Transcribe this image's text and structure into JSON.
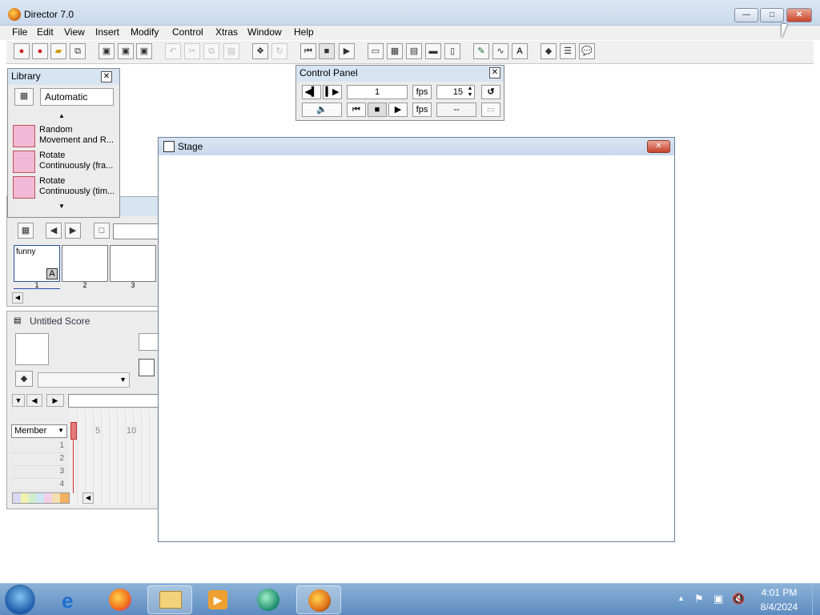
{
  "window": {
    "title": "Director 7.0",
    "min_glyph": "—",
    "max_glyph": "□",
    "close_glyph": "✕"
  },
  "menu": {
    "items": [
      "File",
      "Edit",
      "View",
      "Insert",
      "Modify",
      "Control",
      "Xtras",
      "Window",
      "Help"
    ]
  },
  "library": {
    "title": "Library",
    "category": "Automatic",
    "items": [
      {
        "line1": "Random",
        "line2": "Movement and R..."
      },
      {
        "line1": "Rotate",
        "line2": "Continuously (fra..."
      },
      {
        "line1": "Rotate",
        "line2": "Continuously (tim..."
      }
    ]
  },
  "control_panel": {
    "title": "Control Panel",
    "frame": "1",
    "fps_label": "fps",
    "tempo": "15",
    "actual_fps": "--"
  },
  "cast": {
    "thumbs": [
      {
        "label": "funny",
        "number": "1"
      },
      {
        "label": "",
        "number": "2"
      },
      {
        "label": "",
        "number": "3"
      }
    ]
  },
  "score": {
    "title": "Untitled Score",
    "member_label": "Member",
    "frame_ticks": [
      "5",
      "10"
    ],
    "channels": [
      "1",
      "2",
      "3",
      "4"
    ]
  },
  "stage": {
    "title": "Stage"
  },
  "taskbar": {
    "time": "4:01 PM",
    "date": "8/4/2024"
  }
}
